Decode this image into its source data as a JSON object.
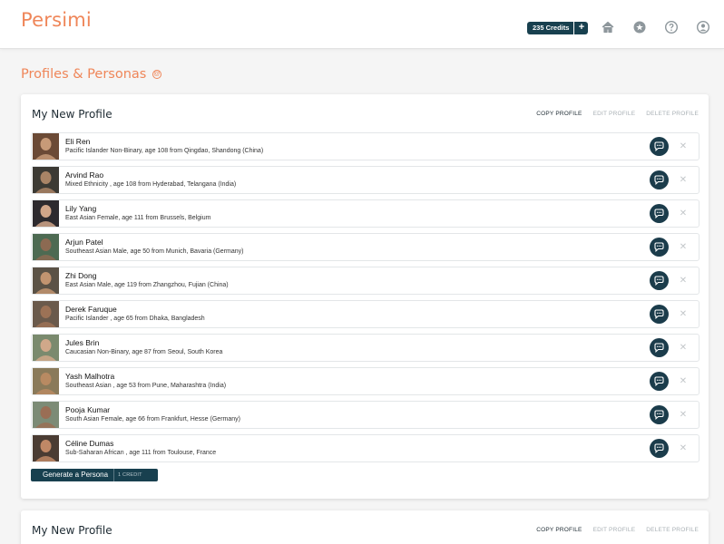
{
  "app": {
    "logo": "Persimi"
  },
  "header": {
    "credits_label": "235 Credits",
    "credits_plus": "+",
    "nav_icons": [
      "home-icon",
      "star-icon",
      "help-icon",
      "user-icon"
    ]
  },
  "page": {
    "title": "Profiles & Personas",
    "help_icon": "@"
  },
  "profiles": [
    {
      "title": "My New Profile",
      "actions": {
        "copy": "COPY PROFILE",
        "edit": "EDIT PROFILE",
        "delete": "DELETE PROFILE"
      },
      "personas": [
        {
          "name": "Eli Ren",
          "description": "Pacific Islander Non-Binary, age 108 from Qingdao, Shandong (China)"
        },
        {
          "name": "Arvind Rao",
          "description": "Mixed Ethnicity , age 108 from Hyderabad, Telangana (India)"
        },
        {
          "name": "Lily Yang",
          "description": "East Asian Female, age 111 from Brussels, Belgium"
        },
        {
          "name": "Arjun Patel",
          "description": "Southeast Asian Male, age 50 from Munich, Bavaria (Germany)"
        },
        {
          "name": "Zhi Dong",
          "description": "East Asian Male, age 119 from Zhangzhou, Fujian (China)"
        },
        {
          "name": "Derek Faruque",
          "description": "Pacific Islander , age 65 from Dhaka, Bangladesh"
        },
        {
          "name": "Jules Brin",
          "description": "Caucasian Non-Binary, age 87 from Seoul, South Korea"
        },
        {
          "name": "Yash Malhotra",
          "description": "Southeast Asian , age 53 from Pune, Maharashtra (India)"
        },
        {
          "name": "Pooja Kumar",
          "description": "South Asian Female, age 66 from Frankfurt, Hesse (Germany)"
        },
        {
          "name": "Céline Dumas",
          "description": "Sub-Saharan African , age 111 from Toulouse, France"
        }
      ],
      "generate": {
        "label": "Generate a Persona",
        "cost": "1 CREDIT"
      }
    },
    {
      "title": "My New Profile",
      "actions": {
        "copy": "COPY PROFILE",
        "edit": "EDIT PROFILE",
        "delete": "DELETE PROFILE"
      }
    }
  ],
  "colors": {
    "brand": "#ef8659",
    "primary": "#18404f",
    "chat_button": "#1b3c4b"
  }
}
